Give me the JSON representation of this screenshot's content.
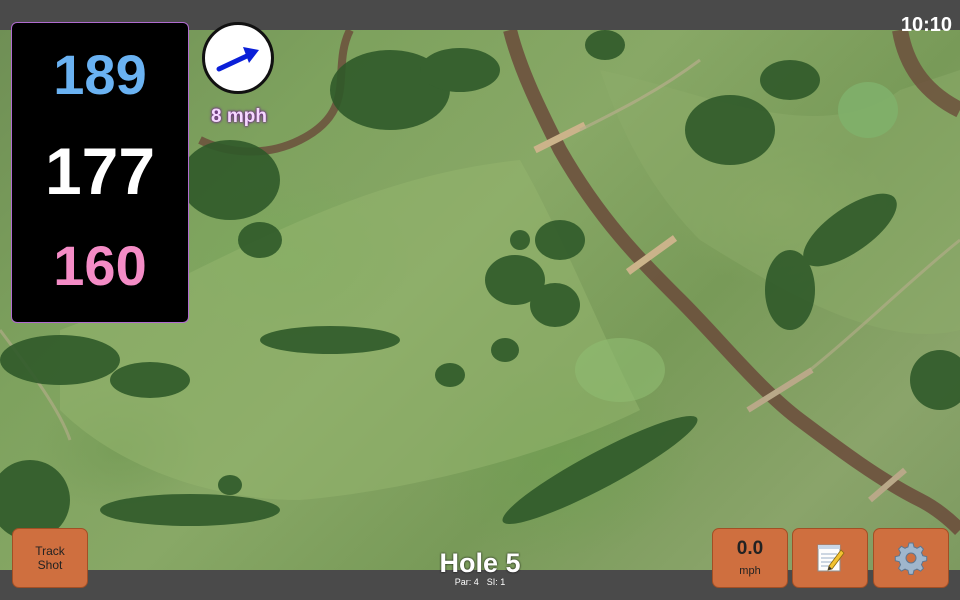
{
  "status": {
    "time": "10:10"
  },
  "distances": {
    "back": "189",
    "middle": "177",
    "front": "160"
  },
  "wind": {
    "speed": "8 mph",
    "icon": "wind-direction-arrow-icon"
  },
  "buttons": {
    "track_shot": {
      "line1": "Track",
      "line2": "Shot"
    },
    "speed": {
      "value": "0.0",
      "unit": "mph"
    },
    "notes_icon": "notepad-icon",
    "settings_icon": "gear-icon"
  },
  "hole": {
    "title": "Hole 5",
    "par": "Par: 4",
    "si": "SI: 1"
  },
  "colors": {
    "back_distance": "#6ab2f2",
    "middle_distance": "#ffffff",
    "front_distance": "#f48cc6",
    "button_bg": "#cf6f3f"
  }
}
